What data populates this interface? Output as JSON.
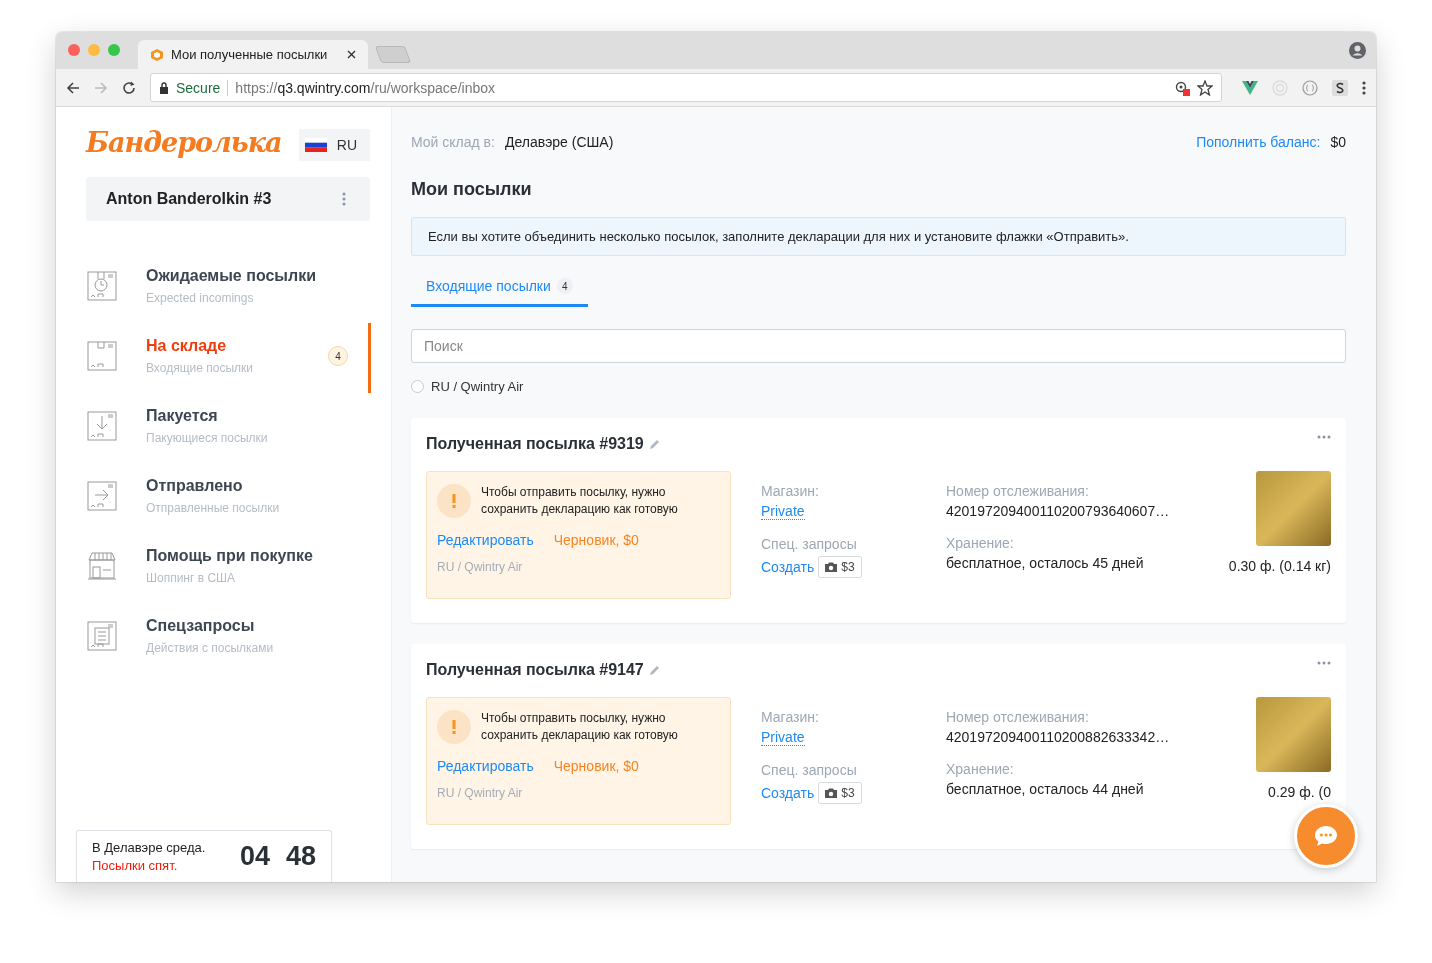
{
  "browser": {
    "tab_title": "Мои полученные посылки",
    "secure_label": "Secure",
    "url_scheme": "https://",
    "url_host": "q3.qwintry.com",
    "url_path": "/ru/workspace/inbox"
  },
  "sidebar": {
    "logo": "Бандеролька",
    "language": "RU",
    "account": "Anton Banderolkin #3",
    "items": [
      {
        "kind": "clock",
        "title": "Ожидаемые посылки",
        "subtitle": "Expected incomings",
        "selected": false
      },
      {
        "kind": "box",
        "title": "На складе",
        "subtitle": "Входящие посылки",
        "selected": true,
        "badge": "4"
      },
      {
        "kind": "down",
        "title": "Пакуется",
        "subtitle": "Пакующиеся посылки",
        "selected": false
      },
      {
        "kind": "right",
        "title": "Отправлено",
        "subtitle": "Отправленные посылки",
        "selected": false
      },
      {
        "kind": "shop",
        "title": "Помощь при покупке",
        "subtitle": "Шоппинг в США",
        "selected": false
      },
      {
        "kind": "list",
        "title": "Спецзапросы",
        "subtitle": "Действия с посылками",
        "selected": false
      }
    ],
    "clock": {
      "line_1": "В Делавэре среда.",
      "line_2": "Посылки спят.",
      "hours": "04",
      "minutes": "48"
    }
  },
  "main": {
    "warehouse_label": "Мой склад в:",
    "warehouse": "Делавэре (США)",
    "balance_link": "Пополнить баланс:",
    "balance": "$0",
    "heading": "Мои посылки",
    "notice": "Если вы хотите объединить несколько посылок, заполните декларации для них и установите флажки «Отправить».",
    "tabs": [
      {
        "label": "Входящие посылки",
        "count": "4",
        "selected": true
      }
    ],
    "search": {
      "placeholder": "Поиск"
    },
    "filters": [
      {
        "label": "RU / Qwintry Air",
        "checked": false
      }
    ],
    "parcels": [
      {
        "title": "Полученная посылка #9319",
        "warning": "Чтобы отправить посылку, нужно сохранить декларацию как готовую",
        "edit_link": "Редактировать",
        "status": "Черновик, $0",
        "route": "RU / Qwintry Air",
        "store_label": "Магазин:",
        "store": "Private",
        "requests_label": "Спец. запросы",
        "create_link": "Создать",
        "photo_price": "$3",
        "tracking_label": "Номер отслеживания:",
        "tracking": "420197209400110200793640607…",
        "storage_label": "Хранение:",
        "storage": "бесплатное, осталось 45 дней",
        "weight": "0.30 ф. (0.14 кг)"
      },
      {
        "title": "Полученная посылка #9147",
        "warning": "Чтобы отправить посылку, нужно сохранить декларацию как готовую",
        "edit_link": "Редактировать",
        "status": "Черновик, $0",
        "route": "RU / Qwintry Air",
        "store_label": "Магазин:",
        "store": "Private",
        "requests_label": "Спец. запросы",
        "create_link": "Создать",
        "photo_price": "$3",
        "tracking_label": "Номер отслеживания:",
        "tracking": "420197209400110200882633342…",
        "storage_label": "Хранение:",
        "storage": "бесплатное, осталось 44 дней",
        "weight": "0.29 ф. (0"
      }
    ]
  }
}
